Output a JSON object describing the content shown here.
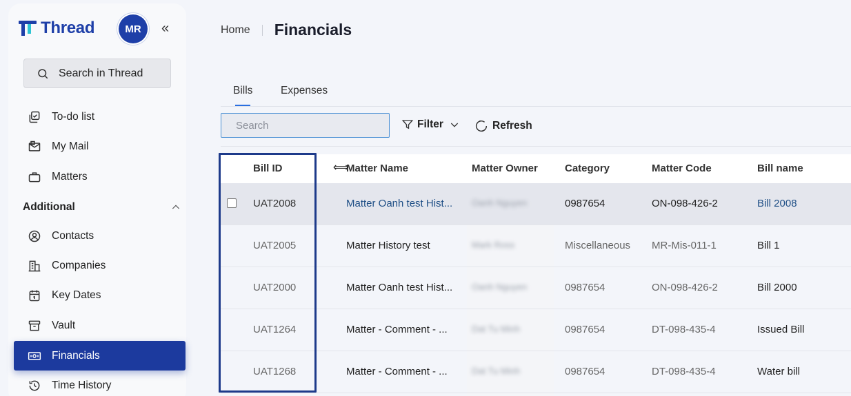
{
  "brand": {
    "name": "Thread",
    "primary": "#1e3fa8",
    "accent": "#2ec5d3"
  },
  "user": {
    "initials": "MR"
  },
  "sidebar": {
    "search_label": "Search in Thread",
    "items": [
      {
        "label": "To-do list",
        "icon": "todo-icon"
      },
      {
        "label": "My Mail",
        "icon": "mail-icon"
      },
      {
        "label": "Matters",
        "icon": "briefcase-icon"
      }
    ],
    "section": {
      "label": "Additional"
    },
    "additional_items": [
      {
        "label": "Contacts",
        "icon": "contact-icon"
      },
      {
        "label": "Companies",
        "icon": "building-icon"
      },
      {
        "label": "Key Dates",
        "icon": "calendar-icon"
      },
      {
        "label": "Vault",
        "icon": "archive-icon"
      },
      {
        "label": "Financials",
        "icon": "money-icon",
        "active": true
      },
      {
        "label": "Time History",
        "icon": "history-icon"
      }
    ]
  },
  "breadcrumb": {
    "home": "Home",
    "title": "Financials"
  },
  "tabs": [
    {
      "label": "Bills",
      "active": true
    },
    {
      "label": "Expenses"
    }
  ],
  "toolbar": {
    "search_placeholder": "Search",
    "filter_label": "Filter",
    "refresh_label": "Refresh"
  },
  "table": {
    "columns": [
      "Bill ID",
      "Matter Name",
      "Matter Owner",
      "Category",
      "Matter Code",
      "Bill name"
    ],
    "rows": [
      {
        "bill_id": "UAT2008",
        "matter_name": "Matter Oanh test Hist...",
        "owner": "Oanh Nguyen",
        "category": "0987654",
        "code": "ON-098-426-2",
        "bill_name": "Bill 2008"
      },
      {
        "bill_id": "UAT2005",
        "matter_name": "Matter History test",
        "owner": "Mark Ross",
        "category": "Miscellaneous",
        "code": "MR-Mis-011-1",
        "bill_name": "Bill 1"
      },
      {
        "bill_id": "UAT2000",
        "matter_name": "Matter Oanh test Hist...",
        "owner": "Oanh Nguyen",
        "category": "0987654",
        "code": "ON-098-426-2",
        "bill_name": "Bill 2000"
      },
      {
        "bill_id": "UAT1264",
        "matter_name": "Matter - Comment - ...",
        "owner": "Dat Tu Minh",
        "category": "0987654",
        "code": "DT-098-435-4",
        "bill_name": "Issued Bill"
      },
      {
        "bill_id": "UAT1268",
        "matter_name": "Matter - Comment - ...",
        "owner": "Dat Tu Minh",
        "category": "0987654",
        "code": "DT-098-435-4",
        "bill_name": "Water bill"
      }
    ]
  }
}
